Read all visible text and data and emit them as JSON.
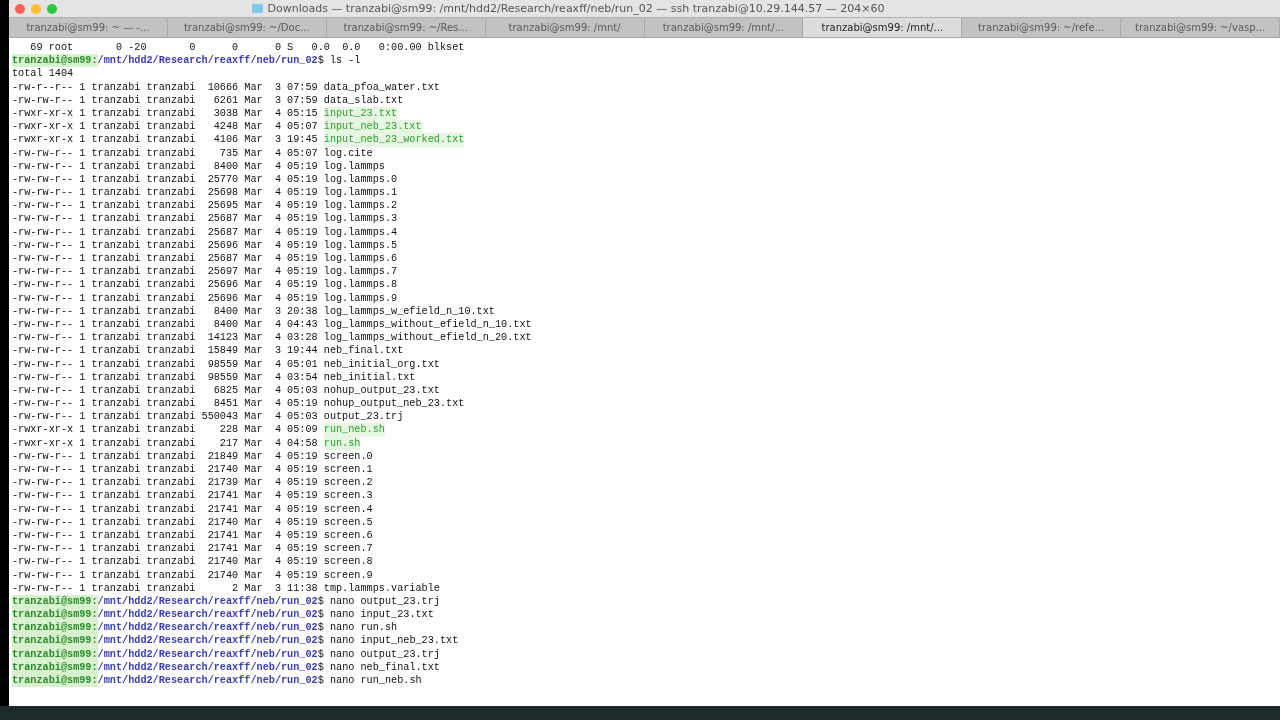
{
  "window": {
    "title": "Downloads — tranzabi@sm99: /mnt/hdd2/Research/reaxff/neb/run_02 — ssh tranzabi@10.29.144.57 — 204×60"
  },
  "tabs": [
    {
      "label": "tranzabi@sm99: ~ — -...",
      "selected": false
    },
    {
      "label": "tranzabi@sm99: ~/Doc...",
      "selected": false
    },
    {
      "label": "tranzabi@sm99: ~/Res...",
      "selected": false
    },
    {
      "label": "tranzabi@sm99: /mnt/",
      "selected": false
    },
    {
      "label": "tranzabi@sm99: /mnt/...",
      "selected": false
    },
    {
      "label": "tranzabi@sm99: /mnt/...",
      "selected": true
    },
    {
      "label": "tranzabi@sm99: ~/refe...",
      "selected": false
    },
    {
      "label": "tranzabi@sm99: ~/vasp...",
      "selected": false
    }
  ],
  "terminal": {
    "lines": [
      {
        "kind": "output",
        "text": "   69 root       0 -20       0      0      0 S   0.0  0.0   0:00.00 blkset"
      },
      {
        "kind": "prompt",
        "user_host": "tranzabi@sm99:",
        "path": "/mnt/hdd2/Research/reaxff/neb/run_02",
        "command": "$ ls -l"
      },
      {
        "kind": "output",
        "text": "total 1404"
      },
      {
        "kind": "listing",
        "details": "-rw-r--r-- 1 tranzabi tranzabi  10666 Mar  3 07:59",
        "name": "data_pfoa_water.txt",
        "executable": false
      },
      {
        "kind": "listing",
        "details": "-rw-rw-r-- 1 tranzabi tranzabi   6261 Mar  3 07:59",
        "name": "data_slab.txt",
        "executable": false
      },
      {
        "kind": "listing",
        "details": "-rwxr-xr-x 1 tranzabi tranzabi   3038 Mar  4 05:15",
        "name": "input_23.txt",
        "executable": true
      },
      {
        "kind": "listing",
        "details": "-rwxr-xr-x 1 tranzabi tranzabi   4248 Mar  4 05:07",
        "name": "input_neb_23.txt",
        "executable": true
      },
      {
        "kind": "listing",
        "details": "-rwxr-xr-x 1 tranzabi tranzabi   4106 Mar  3 19:45",
        "name": "input_neb_23_worked.txt",
        "executable": true
      },
      {
        "kind": "listing",
        "details": "-rw-rw-r-- 1 tranzabi tranzabi    735 Mar  4 05:07",
        "name": "log.cite",
        "executable": false
      },
      {
        "kind": "listing",
        "details": "-rw-rw-r-- 1 tranzabi tranzabi   8400 Mar  4 05:19",
        "name": "log.lammps",
        "executable": false
      },
      {
        "kind": "listing",
        "details": "-rw-rw-r-- 1 tranzabi tranzabi  25770 Mar  4 05:19",
        "name": "log.lammps.0",
        "executable": false
      },
      {
        "kind": "listing",
        "details": "-rw-rw-r-- 1 tranzabi tranzabi  25698 Mar  4 05:19",
        "name": "log.lammps.1",
        "executable": false
      },
      {
        "kind": "listing",
        "details": "-rw-rw-r-- 1 tranzabi tranzabi  25695 Mar  4 05:19",
        "name": "log.lammps.2",
        "executable": false
      },
      {
        "kind": "listing",
        "details": "-rw-rw-r-- 1 tranzabi tranzabi  25687 Mar  4 05:19",
        "name": "log.lammps.3",
        "executable": false
      },
      {
        "kind": "listing",
        "details": "-rw-rw-r-- 1 tranzabi tranzabi  25687 Mar  4 05:19",
        "name": "log.lammps.4",
        "executable": false
      },
      {
        "kind": "listing",
        "details": "-rw-rw-r-- 1 tranzabi tranzabi  25696 Mar  4 05:19",
        "name": "log.lammps.5",
        "executable": false
      },
      {
        "kind": "listing",
        "details": "-rw-rw-r-- 1 tranzabi tranzabi  25687 Mar  4 05:19",
        "name": "log.lammps.6",
        "executable": false
      },
      {
        "kind": "listing",
        "details": "-rw-rw-r-- 1 tranzabi tranzabi  25697 Mar  4 05:19",
        "name": "log.lammps.7",
        "executable": false
      },
      {
        "kind": "listing",
        "details": "-rw-rw-r-- 1 tranzabi tranzabi  25696 Mar  4 05:19",
        "name": "log.lammps.8",
        "executable": false
      },
      {
        "kind": "listing",
        "details": "-rw-rw-r-- 1 tranzabi tranzabi  25696 Mar  4 05:19",
        "name": "log.lammps.9",
        "executable": false
      },
      {
        "kind": "listing",
        "details": "-rw-rw-r-- 1 tranzabi tranzabi   8400 Mar  3 20:38",
        "name": "log_lammps_w_efield_n_10.txt",
        "executable": false
      },
      {
        "kind": "listing",
        "details": "-rw-rw-r-- 1 tranzabi tranzabi   8400 Mar  4 04:43",
        "name": "log_lammps_without_efield_n_10.txt",
        "executable": false
      },
      {
        "kind": "listing",
        "details": "-rw-rw-r-- 1 tranzabi tranzabi  14123 Mar  4 03:28",
        "name": "log_lammps_without_efield_n_20.txt",
        "executable": false
      },
      {
        "kind": "listing",
        "details": "-rw-rw-r-- 1 tranzabi tranzabi  15849 Mar  3 19:44",
        "name": "neb_final.txt",
        "executable": false
      },
      {
        "kind": "listing",
        "details": "-rw-rw-r-- 1 tranzabi tranzabi  98559 Mar  4 05:01",
        "name": "neb_initial_org.txt",
        "executable": false
      },
      {
        "kind": "listing",
        "details": "-rw-rw-r-- 1 tranzabi tranzabi  98559 Mar  4 03:54",
        "name": "neb_initial.txt",
        "executable": false
      },
      {
        "kind": "listing",
        "details": "-rw-rw-r-- 1 tranzabi tranzabi   6825 Mar  4 05:03",
        "name": "nohup_output_23.txt",
        "executable": false
      },
      {
        "kind": "listing",
        "details": "-rw-rw-r-- 1 tranzabi tranzabi   8451 Mar  4 05:19",
        "name": "nohup_output_neb_23.txt",
        "executable": false
      },
      {
        "kind": "listing",
        "details": "-rw-rw-r-- 1 tranzabi tranzabi 550043 Mar  4 05:03",
        "name": "output_23.trj",
        "executable": false
      },
      {
        "kind": "listing",
        "details": "-rwxr-xr-x 1 tranzabi tranzabi    228 Mar  4 05:09",
        "name": "run_neb.sh",
        "executable": true
      },
      {
        "kind": "listing",
        "details": "-rwxr-xr-x 1 tranzabi tranzabi    217 Mar  4 04:58",
        "name": "run.sh",
        "executable": true
      },
      {
        "kind": "listing",
        "details": "-rw-rw-r-- 1 tranzabi tranzabi  21849 Mar  4 05:19",
        "name": "screen.0",
        "executable": false
      },
      {
        "kind": "listing",
        "details": "-rw-rw-r-- 1 tranzabi tranzabi  21740 Mar  4 05:19",
        "name": "screen.1",
        "executable": false
      },
      {
        "kind": "listing",
        "details": "-rw-rw-r-- 1 tranzabi tranzabi  21739 Mar  4 05:19",
        "name": "screen.2",
        "executable": false
      },
      {
        "kind": "listing",
        "details": "-rw-rw-r-- 1 tranzabi tranzabi  21741 Mar  4 05:19",
        "name": "screen.3",
        "executable": false
      },
      {
        "kind": "listing",
        "details": "-rw-rw-r-- 1 tranzabi tranzabi  21741 Mar  4 05:19",
        "name": "screen.4",
        "executable": false
      },
      {
        "kind": "listing",
        "details": "-rw-rw-r-- 1 tranzabi tranzabi  21740 Mar  4 05:19",
        "name": "screen.5",
        "executable": false
      },
      {
        "kind": "listing",
        "details": "-rw-rw-r-- 1 tranzabi tranzabi  21741 Mar  4 05:19",
        "name": "screen.6",
        "executable": false
      },
      {
        "kind": "listing",
        "details": "-rw-rw-r-- 1 tranzabi tranzabi  21741 Mar  4 05:19",
        "name": "screen.7",
        "executable": false
      },
      {
        "kind": "listing",
        "details": "-rw-rw-r-- 1 tranzabi tranzabi  21740 Mar  4 05:19",
        "name": "screen.8",
        "executable": false
      },
      {
        "kind": "listing",
        "details": "-rw-rw-r-- 1 tranzabi tranzabi  21740 Mar  4 05:19",
        "name": "screen.9",
        "executable": false
      },
      {
        "kind": "listing",
        "details": "-rw-rw-r-- 1 tranzabi tranzabi      2 Mar  3 11:38",
        "name": "tmp.lammps.variable",
        "executable": false
      },
      {
        "kind": "prompt",
        "user_host": "tranzabi@sm99:",
        "path": "/mnt/hdd2/Research/reaxff/neb/run_02",
        "command": "$ nano output_23.trj"
      },
      {
        "kind": "prompt",
        "user_host": "tranzabi@sm99:",
        "path": "/mnt/hdd2/Research/reaxff/neb/run_02",
        "command": "$ nano input_23.txt"
      },
      {
        "kind": "prompt",
        "user_host": "tranzabi@sm99:",
        "path": "/mnt/hdd2/Research/reaxff/neb/run_02",
        "command": "$ nano run.sh"
      },
      {
        "kind": "prompt",
        "user_host": "tranzabi@sm99:",
        "path": "/mnt/hdd2/Research/reaxff/neb/run_02",
        "command": "$ nano input_neb_23.txt"
      },
      {
        "kind": "prompt",
        "user_host": "tranzabi@sm99:",
        "path": "/mnt/hdd2/Research/reaxff/neb/run_02",
        "command": "$ nano output_23.trj"
      },
      {
        "kind": "prompt",
        "user_host": "tranzabi@sm99:",
        "path": "/mnt/hdd2/Research/reaxff/neb/run_02",
        "command": "$ nano neb_final.txt"
      },
      {
        "kind": "prompt",
        "user_host": "tranzabi@sm99:",
        "path": "/mnt/hdd2/Research/reaxff/neb/run_02",
        "command": "$ nano run_neb.sh"
      }
    ]
  }
}
